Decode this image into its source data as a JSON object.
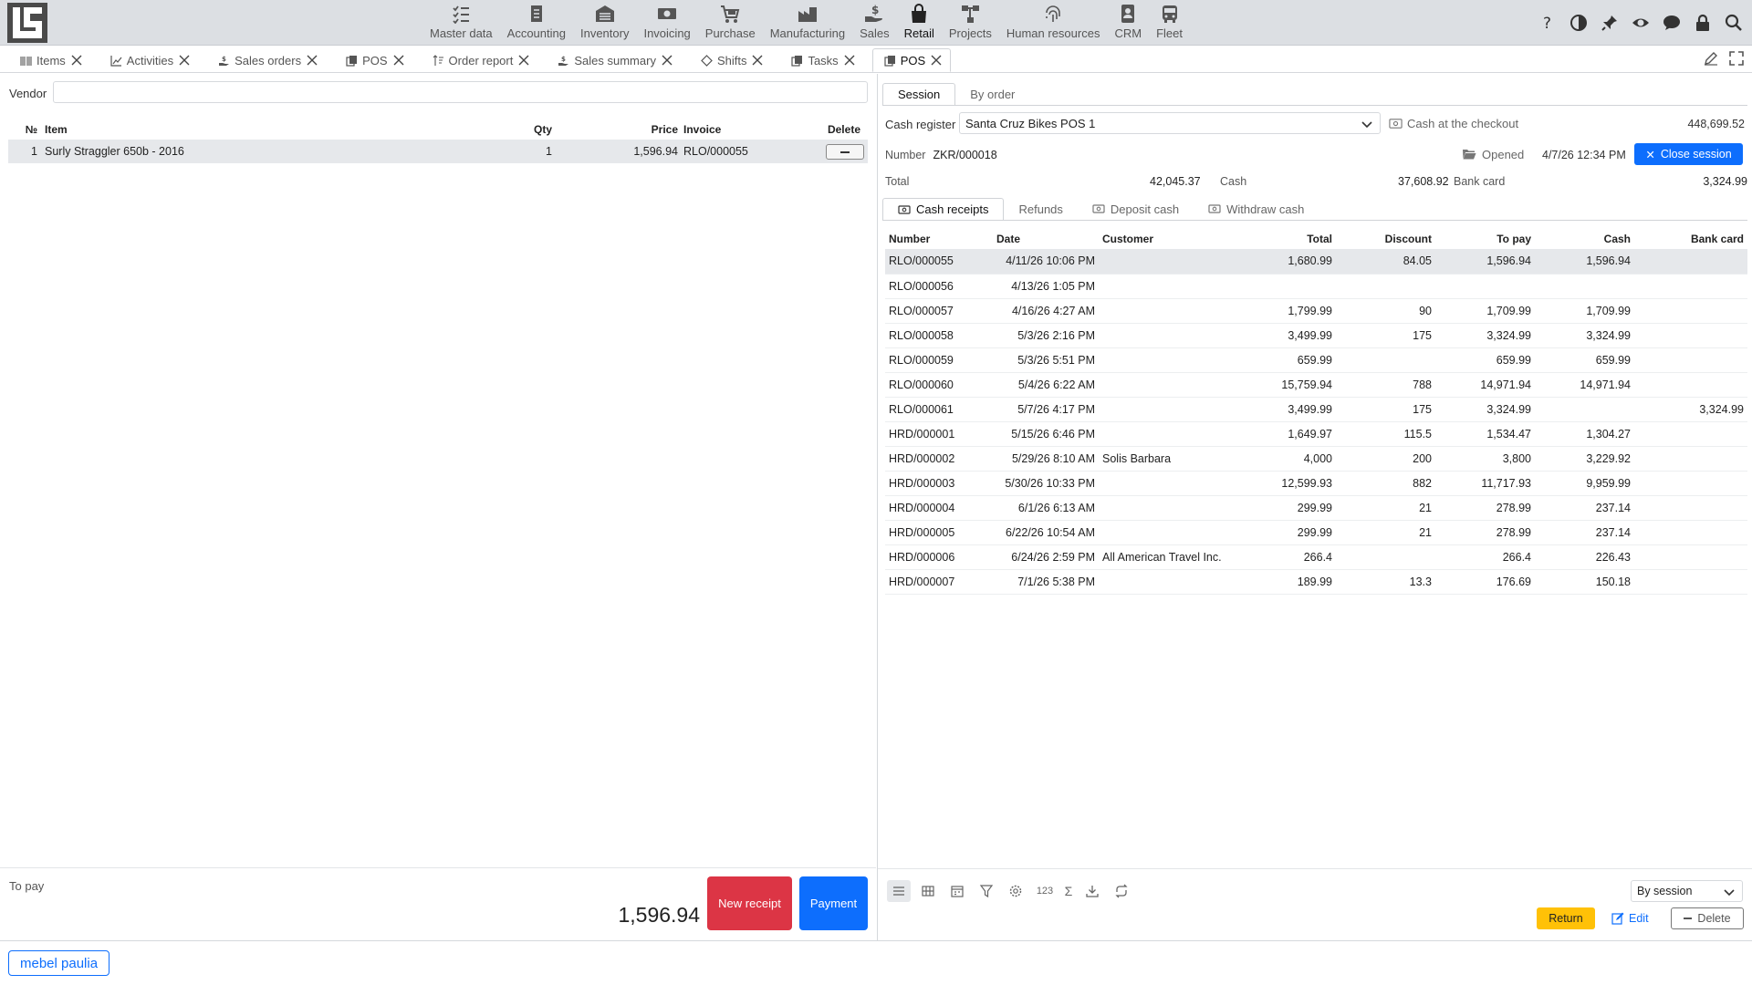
{
  "nav": {
    "items": [
      {
        "label": "Master data",
        "icon": "list-check-icon"
      },
      {
        "label": "Accounting",
        "icon": "ledger-icon"
      },
      {
        "label": "Inventory",
        "icon": "warehouse-icon"
      },
      {
        "label": "Invoicing",
        "icon": "money-icon"
      },
      {
        "label": "Purchase",
        "icon": "cart-icon"
      },
      {
        "label": "Manufacturing",
        "icon": "factory-icon"
      },
      {
        "label": "Sales",
        "icon": "hand-dollar-icon"
      },
      {
        "label": "Retail",
        "icon": "shopping-bag-icon"
      },
      {
        "label": "Projects",
        "icon": "diagram-icon"
      },
      {
        "label": "Human resources",
        "icon": "fingerprint-icon"
      },
      {
        "label": "CRM",
        "icon": "contact-card-icon"
      },
      {
        "label": "Fleet",
        "icon": "bus-icon"
      }
    ],
    "active": "Retail"
  },
  "tabs": [
    {
      "label": "Items",
      "icon": "barcode-icon"
    },
    {
      "label": "Activities",
      "icon": "chart-line-icon"
    },
    {
      "label": "Sales orders",
      "icon": "hand-dollar-icon"
    },
    {
      "label": "POS",
      "icon": "copy-icon"
    },
    {
      "label": "Order report",
      "icon": "sort-icon"
    },
    {
      "label": "Sales summary",
      "icon": "hand-dollar-icon"
    },
    {
      "label": "Shifts",
      "icon": "diamond-icon"
    },
    {
      "label": "Tasks",
      "icon": "copy-icon"
    },
    {
      "label": "POS",
      "icon": "copy-icon"
    }
  ],
  "left": {
    "vendor_label": "Vendor",
    "vendor_value": "",
    "columns": {
      "no": "№",
      "item": "Item",
      "qty": "Qty",
      "price": "Price",
      "invoice": "Invoice",
      "delete": "Delete"
    },
    "rows": [
      {
        "no": "1",
        "item": "Surly Straggler 650b - 2016",
        "qty": "1",
        "price": "1,596.94",
        "invoice": "RLO/000055"
      }
    ],
    "to_pay_label": "To pay",
    "to_pay_value": "1,596.94",
    "new_receipt": "New receipt",
    "payment": "Payment"
  },
  "right": {
    "tab_session": "Session",
    "tab_by_order": "By order",
    "cash_register_label": "Cash register",
    "cash_register_value": "Santa Cruz Bikes POS 1",
    "cash_checkout_label": "Cash at the checkout",
    "cash_checkout_value": "448,699.52",
    "number_label": "Number",
    "number_value": "ZKR/000018",
    "opened_label": "Opened",
    "opened_date": "4/7/26 12:34 PM",
    "close_session": "Close session",
    "total_label": "Total",
    "total_value": "42,045.37",
    "cash_label": "Cash",
    "cash_value": "37,608.92",
    "bank_label": "Bank card",
    "bank_value": "3,324.99",
    "subtabs": [
      "Cash receipts",
      "Refunds",
      "Deposit cash",
      "Withdraw cash"
    ],
    "columns": {
      "number": "Number",
      "date": "Date",
      "customer": "Customer",
      "total": "Total",
      "discount": "Discount",
      "topay": "To pay",
      "cash": "Cash",
      "bank": "Bank card"
    },
    "rows": [
      {
        "number": "RLO/000055",
        "date": "4/11/26 10:06 PM",
        "customer": "",
        "total": "1,680.99",
        "discount": "84.05",
        "topay": "1,596.94",
        "cash": "1,596.94",
        "bank": ""
      },
      {
        "number": "RLO/000056",
        "date": "4/13/26 1:05 PM",
        "customer": "",
        "total": "",
        "discount": "",
        "topay": "",
        "cash": "",
        "bank": ""
      },
      {
        "number": "RLO/000057",
        "date": "4/16/26 4:27 AM",
        "customer": "",
        "total": "1,799.99",
        "discount": "90",
        "topay": "1,709.99",
        "cash": "1,709.99",
        "bank": ""
      },
      {
        "number": "RLO/000058",
        "date": "5/3/26 2:16 PM",
        "customer": "",
        "total": "3,499.99",
        "discount": "175",
        "topay": "3,324.99",
        "cash": "3,324.99",
        "bank": ""
      },
      {
        "number": "RLO/000059",
        "date": "5/3/26 5:51 PM",
        "customer": "",
        "total": "659.99",
        "discount": "",
        "topay": "659.99",
        "cash": "659.99",
        "bank": ""
      },
      {
        "number": "RLO/000060",
        "date": "5/4/26 6:22 AM",
        "customer": "",
        "total": "15,759.94",
        "discount": "788",
        "topay": "14,971.94",
        "cash": "14,971.94",
        "bank": ""
      },
      {
        "number": "RLO/000061",
        "date": "5/7/26 4:17 PM",
        "customer": "",
        "total": "3,499.99",
        "discount": "175",
        "topay": "3,324.99",
        "cash": "",
        "bank": "3,324.99"
      },
      {
        "number": "HRD/000001",
        "date": "5/15/26 6:46 PM",
        "customer": "",
        "total": "1,649.97",
        "discount": "115.5",
        "topay": "1,534.47",
        "cash": "1,304.27",
        "bank": ""
      },
      {
        "number": "HRD/000002",
        "date": "5/29/26 8:10 AM",
        "customer": "Solis Barbara",
        "total": "4,000",
        "discount": "200",
        "topay": "3,800",
        "cash": "3,229.92",
        "bank": ""
      },
      {
        "number": "HRD/000003",
        "date": "5/30/26 10:33 PM",
        "customer": "",
        "total": "12,599.93",
        "discount": "882",
        "topay": "11,717.93",
        "cash": "9,959.99",
        "bank": ""
      },
      {
        "number": "HRD/000004",
        "date": "6/1/26 6:13 AM",
        "customer": "",
        "total": "299.99",
        "discount": "21",
        "topay": "278.99",
        "cash": "237.14",
        "bank": ""
      },
      {
        "number": "HRD/000005",
        "date": "6/22/26 10:54 AM",
        "customer": "",
        "total": "299.99",
        "discount": "21",
        "topay": "278.99",
        "cash": "237.14",
        "bank": ""
      },
      {
        "number": "HRD/000006",
        "date": "6/24/26 2:59 PM",
        "customer": "All American Travel Inc.",
        "total": "266.4",
        "discount": "",
        "topay": "266.4",
        "cash": "226.43",
        "bank": ""
      },
      {
        "number": "HRD/000007",
        "date": "7/1/26 5:38 PM",
        "customer": "",
        "total": "189.99",
        "discount": "13.3",
        "topay": "176.69",
        "cash": "150.18",
        "bank": ""
      }
    ],
    "tools_number_label": "123",
    "by_session": "By session",
    "return": "Return",
    "edit": "Edit",
    "delete": "Delete"
  },
  "status": {
    "user": "mebel paulia"
  },
  "colors": {
    "primary": "#0d6efd",
    "danger": "#dc3545",
    "warning": "#ffc107"
  }
}
